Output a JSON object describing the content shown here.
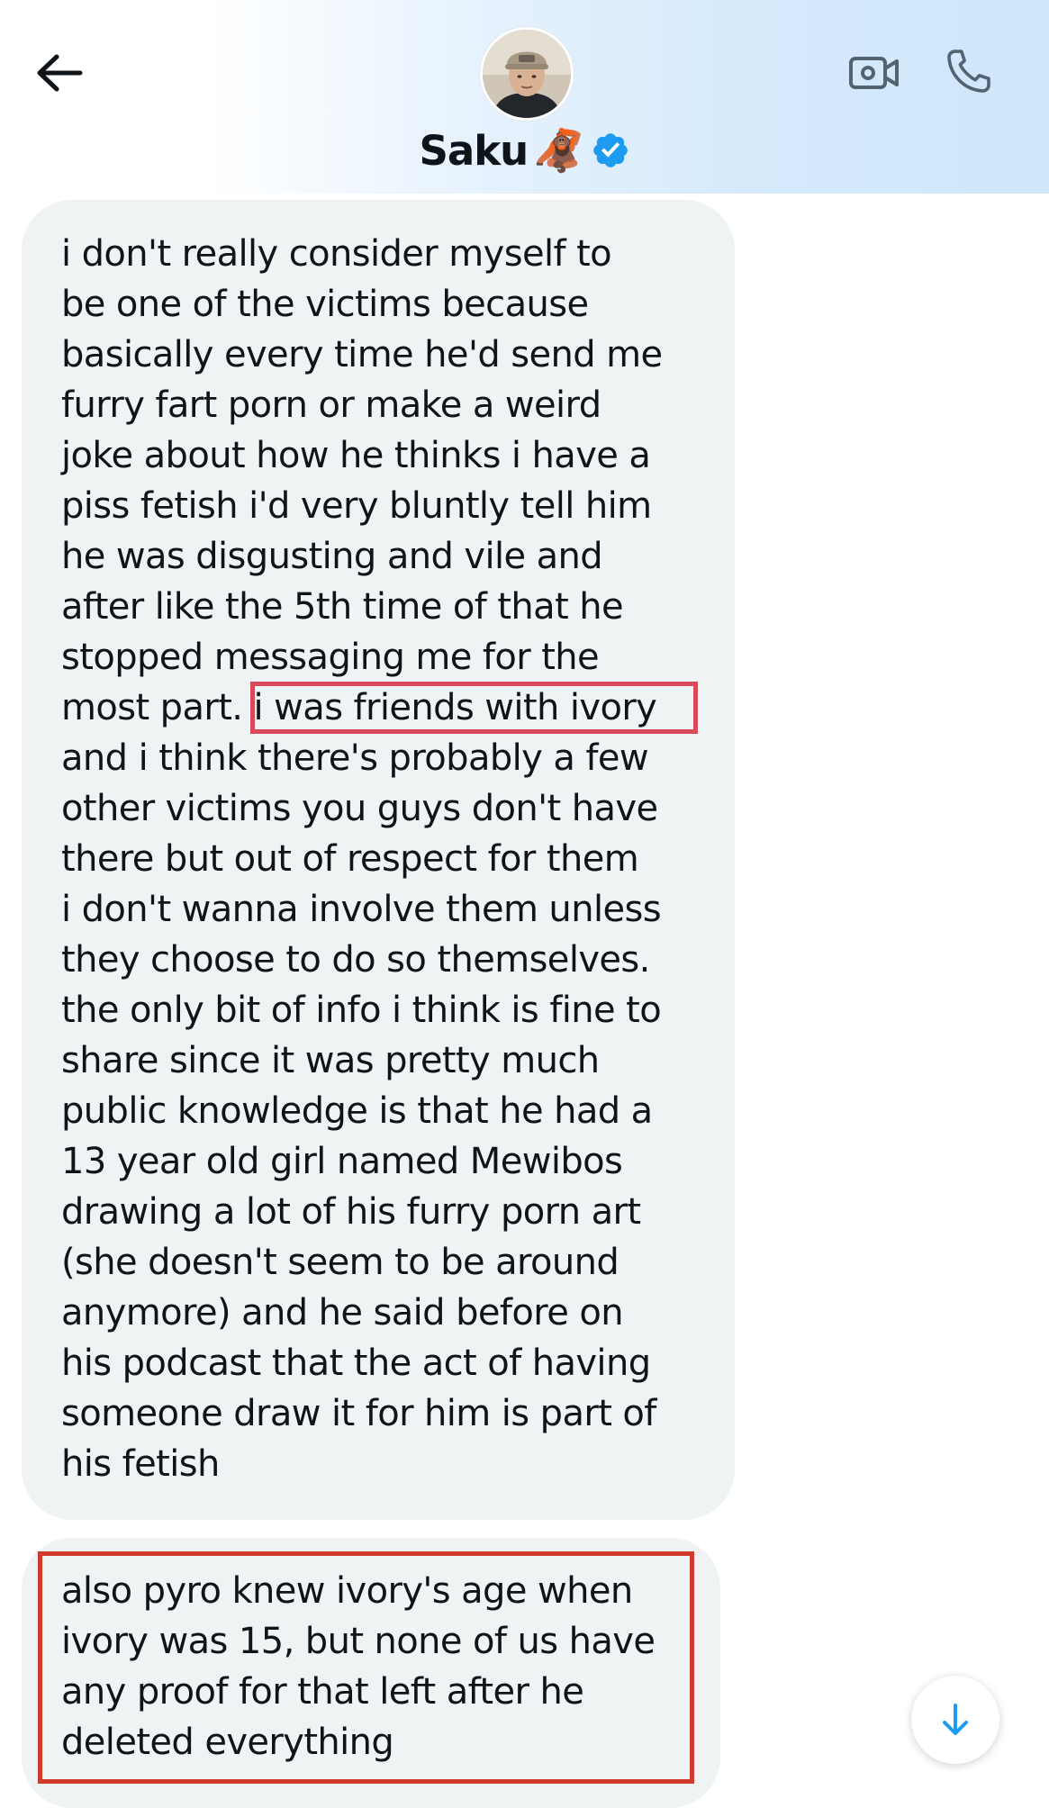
{
  "header": {
    "contact_name": "Saku",
    "name_emoji": "🦧",
    "verified": true,
    "back_icon": "arrow-left-icon",
    "video_icon": "video-camera-icon",
    "call_icon": "phone-icon"
  },
  "messages": [
    {
      "lines": [
        "i don't really consider myself to",
        "be one of the victims because",
        "basically every time he'd send me",
        "furry fart porn or make a weird",
        "joke about how he thinks i have a",
        "piss fetish i'd very bluntly tell him",
        "he was disgusting and vile and",
        "after like the 5th time of that he",
        "stopped messaging me for the",
        "most part. i was friends with ivory",
        "and i think there's probably a few",
        "other victims you guys don't have",
        "there but out of respect for them",
        "i don't wanna involve them unless",
        "they choose to do so themselves.",
        "the only bit of info i think is fine to",
        "share since it was pretty much",
        "public knowledge is that he had a",
        "13 year old girl named Mewibos",
        "drawing a lot of his furry porn art",
        "(she doesn't seem to be around",
        "anymore) and he said before on",
        "his podcast that the act of having",
        "someone draw it for him is part of",
        "his fetish"
      ]
    },
    {
      "lines": [
        "also pyro knew ivory's age when",
        "ivory was 15, but none of us have",
        "any proof for that left after he",
        "deleted everything"
      ]
    }
  ],
  "colors": {
    "bubble_bg": "#eff3f4",
    "verified_blue": "#1d9bf0",
    "highlight_red": "#d94a52",
    "text": "#0f1419"
  },
  "scroll_button_icon": "arrow-down-icon"
}
